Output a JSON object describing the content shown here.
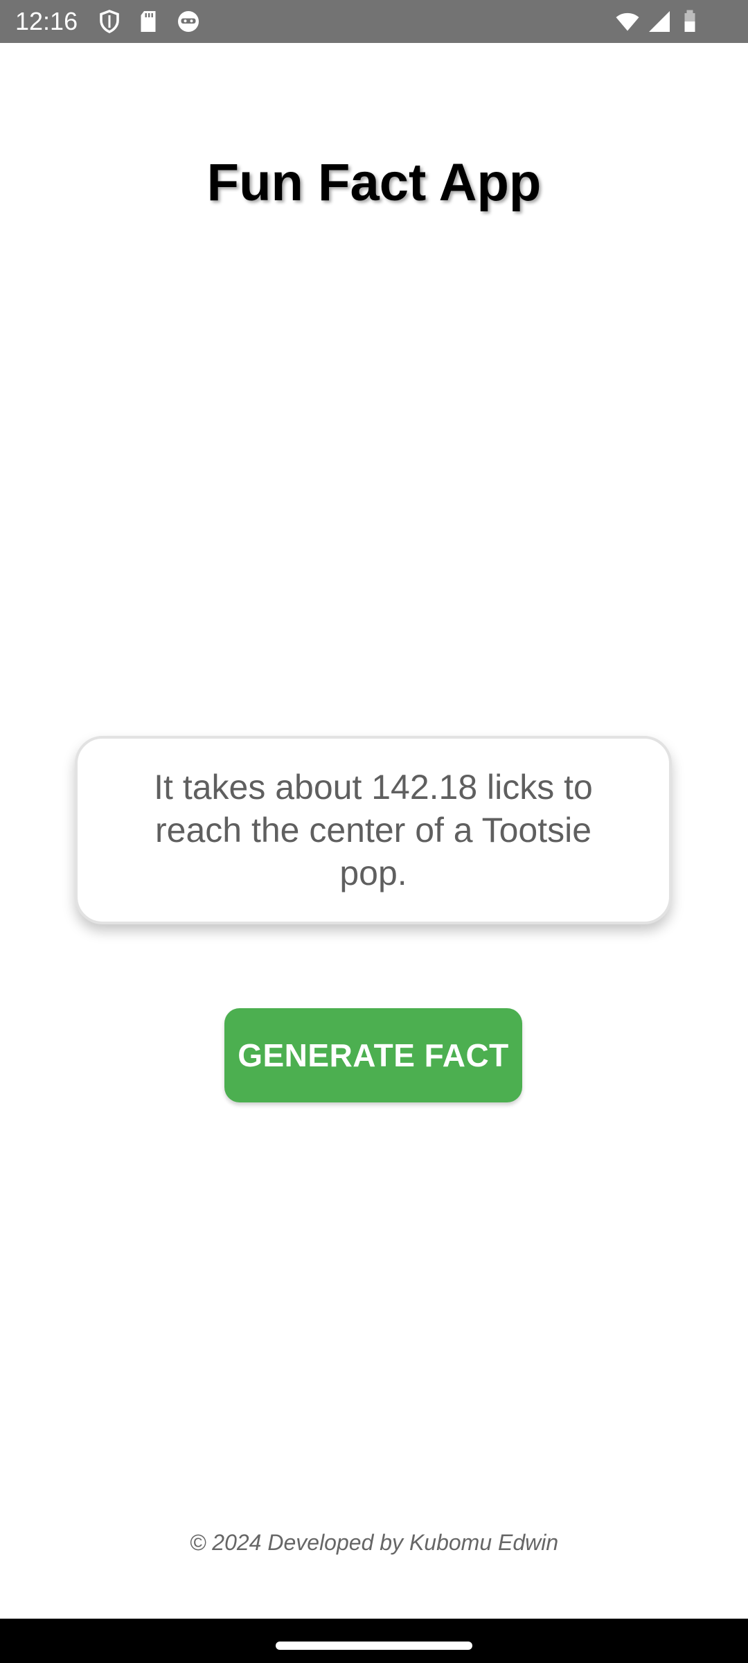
{
  "status_bar": {
    "time": "12:16",
    "icons_left": [
      "shield-icon",
      "sd-card-icon",
      "face-icon"
    ],
    "icons_right": [
      "wifi-icon",
      "signal-icon",
      "battery-icon"
    ]
  },
  "app": {
    "title": "Fun Fact App"
  },
  "fact_card": {
    "text": "It takes about 142.18 licks to reach the center of a Tootsie pop."
  },
  "actions": {
    "generate_label": "GENERATE FACT"
  },
  "footer": {
    "text": "© 2024 Developed by Kubomu Edwin"
  },
  "colors": {
    "status_bar_bg": "#737373",
    "button_bg": "#4caf50",
    "fact_text": "#5f5f5f",
    "nav_bar_bg": "#000000"
  }
}
